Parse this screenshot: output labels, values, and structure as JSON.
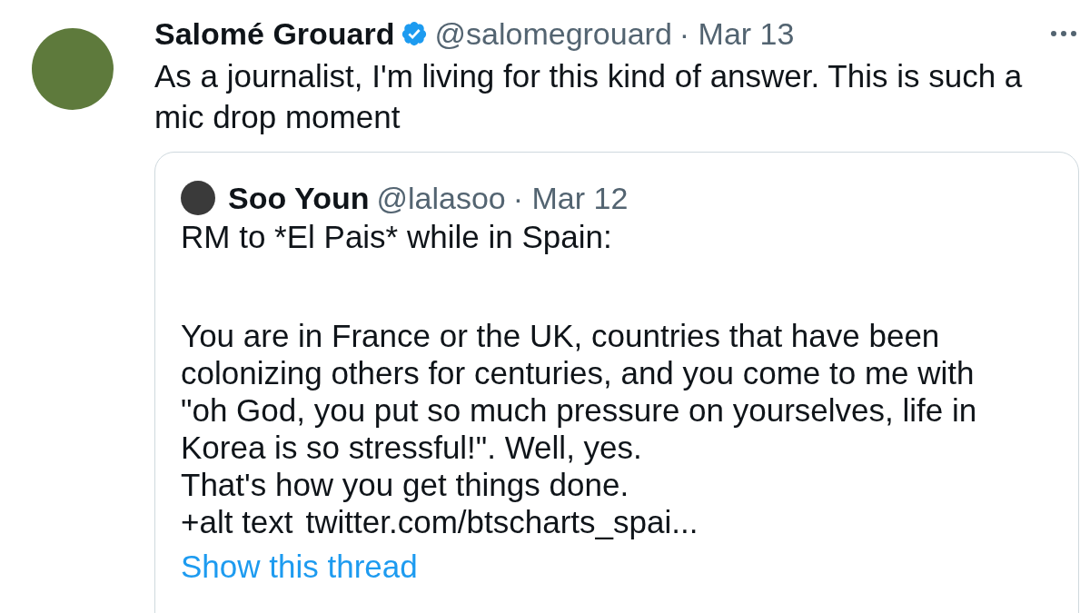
{
  "tweet": {
    "author": {
      "name": "Salomé Grouard",
      "verified": true,
      "handle": "@salomegrouard",
      "date": "· Mar 13"
    },
    "text": "As a journalist, I'm living for this kind of answer. This is such a mic drop moment",
    "quote": {
      "author": {
        "name": "Soo Youn",
        "handle": "@lalasoo",
        "date": "· Mar 12"
      },
      "intro": "RM to *El Pais* while in Spain:",
      "lines": [
        "You are in France or the UK, countries that have been colonizing others for centuries, and you come to me with \"oh God, you put so much pressure on yourselves, life in Korea is so stressful!\". Well, yes.",
        "That's how you get things done."
      ],
      "alt_text": "+alt text",
      "link": "twitter.com/btscharts_spai...",
      "show_thread": "Show this thread"
    }
  }
}
